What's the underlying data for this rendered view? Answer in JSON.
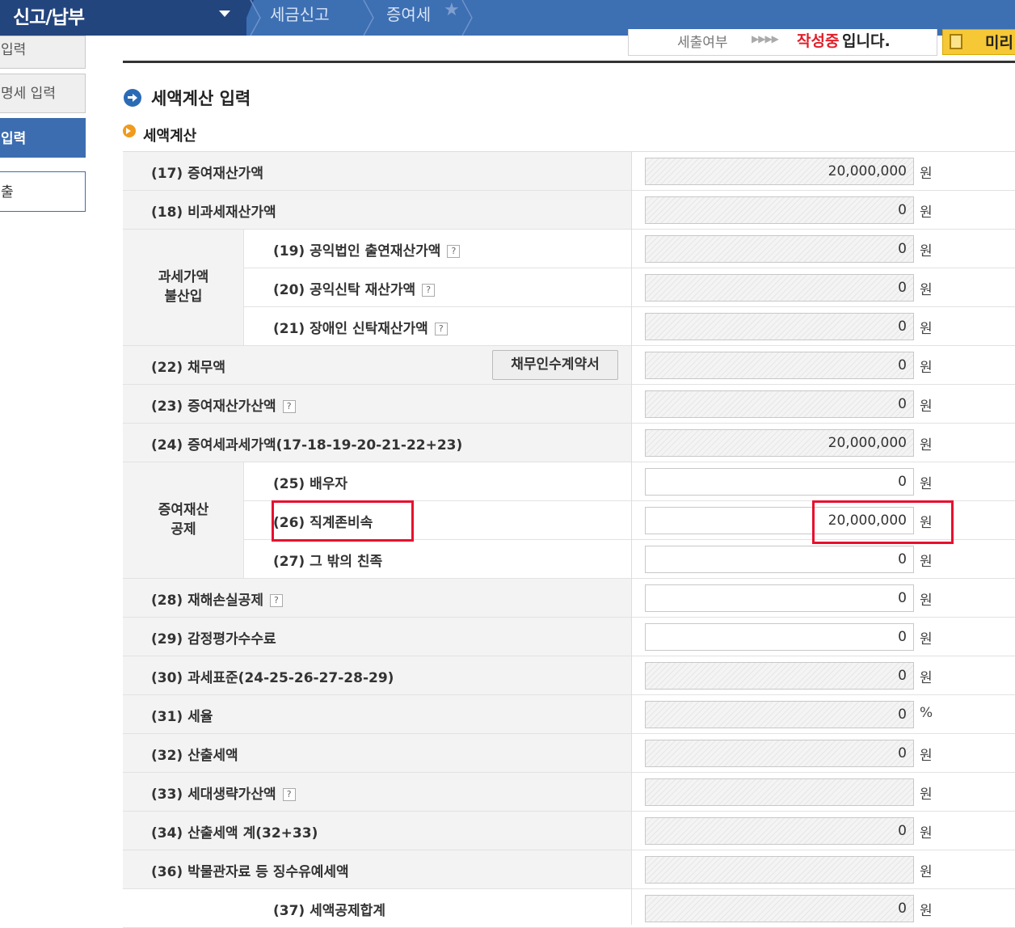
{
  "topbar": {
    "menu_title": "신고/납부",
    "breadcrumb": [
      "세금신고",
      "증여세"
    ]
  },
  "sidebar": {
    "items": [
      {
        "label": "입력",
        "state": "default"
      },
      {
        "label": "명세 입력",
        "state": "default"
      },
      {
        "label": "입력",
        "state": "active"
      },
      {
        "label": "출",
        "state": "outline"
      }
    ]
  },
  "status": {
    "label": "세출여부",
    "state_highlight": "작성중",
    "state_suffix": "입니다.",
    "preview_label": "미리"
  },
  "section": {
    "title": "세액계산 입력",
    "subtitle": "세액계산"
  },
  "groups": {
    "nontax": "과세가액\n불산입",
    "deduction": "증여재산\n공제"
  },
  "debt_button": "채무인수계약서",
  "rows": [
    {
      "num": "(17)",
      "label": "증여재산가액",
      "help": false,
      "value": "20,000,000",
      "unit": "원",
      "readonly": true
    },
    {
      "num": "(18)",
      "label": "비과세재산가액",
      "help": false,
      "value": "0",
      "unit": "원",
      "readonly": true
    },
    {
      "num": "(19)",
      "label": "공익법인 출연재산가액",
      "help": true,
      "value": "0",
      "unit": "원",
      "readonly": true
    },
    {
      "num": "(20)",
      "label": "공익신탁 재산가액",
      "help": true,
      "value": "0",
      "unit": "원",
      "readonly": true
    },
    {
      "num": "(21)",
      "label": "장애인 신탁재산가액",
      "help": true,
      "value": "0",
      "unit": "원",
      "readonly": true
    },
    {
      "num": "(22)",
      "label": "채무액",
      "help": false,
      "value": "0",
      "unit": "원",
      "readonly": true
    },
    {
      "num": "(23)",
      "label": "증여재산가산액",
      "help": true,
      "value": "0",
      "unit": "원",
      "readonly": true
    },
    {
      "num": "(24)",
      "label": "증여세과세가액(17-18-19-20-21-22+23)",
      "help": false,
      "value": "20,000,000",
      "unit": "원",
      "readonly": true
    },
    {
      "num": "(25)",
      "label": "배우자",
      "help": false,
      "value": "0",
      "unit": "원",
      "readonly": false
    },
    {
      "num": "(26)",
      "label": "직계존비속",
      "help": false,
      "value": "20,000,000",
      "unit": "원",
      "readonly": false
    },
    {
      "num": "(27)",
      "label": "그 밖의 친족",
      "help": false,
      "value": "0",
      "unit": "원",
      "readonly": false
    },
    {
      "num": "(28)",
      "label": "재해손실공제",
      "help": true,
      "value": "0",
      "unit": "원",
      "readonly": false
    },
    {
      "num": "(29)",
      "label": "감정평가수수료",
      "help": false,
      "value": "0",
      "unit": "원",
      "readonly": false
    },
    {
      "num": "(30)",
      "label": "과세표준(24-25-26-27-28-29)",
      "help": false,
      "value": "0",
      "unit": "원",
      "readonly": true
    },
    {
      "num": "(31)",
      "label": "세율",
      "help": false,
      "value": "0",
      "unit": "%",
      "readonly": true
    },
    {
      "num": "(32)",
      "label": "산출세액",
      "help": false,
      "value": "0",
      "unit": "원",
      "readonly": true
    },
    {
      "num": "(33)",
      "label": "세대생략가산액",
      "help": true,
      "value": "",
      "unit": "원",
      "readonly": true
    },
    {
      "num": "(34)",
      "label": "산출세액 계(32+33)",
      "help": false,
      "value": "0",
      "unit": "원",
      "readonly": true
    },
    {
      "num": "(36)",
      "label": "박물관자료 등 징수유예세액",
      "help": false,
      "value": "",
      "unit": "원",
      "readonly": true
    },
    {
      "num": "(37)",
      "label": "세액공제합계",
      "help": false,
      "value": "0",
      "unit": "원",
      "readonly": true
    }
  ]
}
